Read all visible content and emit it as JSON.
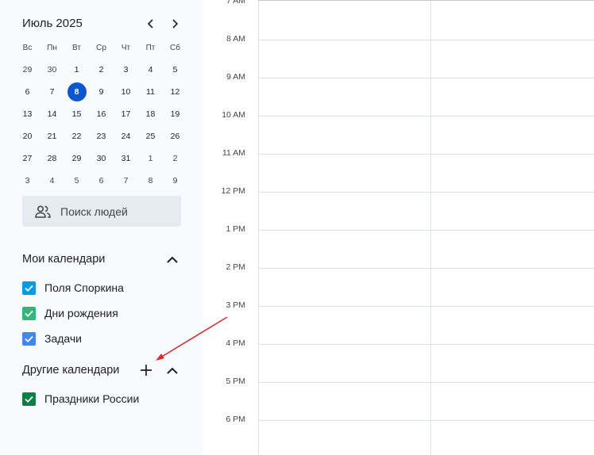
{
  "mini_calendar": {
    "month_title": "Июль 2025",
    "prev_icon": "chevron-left-icon",
    "next_icon": "chevron-right-icon",
    "weekdays": [
      "Вс",
      "Пн",
      "Вт",
      "Ср",
      "Чт",
      "Пт",
      "Сб"
    ],
    "weeks": [
      [
        "29",
        "30",
        "1",
        "2",
        "3",
        "4",
        "5"
      ],
      [
        "6",
        "7",
        "8",
        "9",
        "10",
        "11",
        "12"
      ],
      [
        "13",
        "14",
        "15",
        "16",
        "17",
        "18",
        "19"
      ],
      [
        "20",
        "21",
        "22",
        "23",
        "24",
        "25",
        "26"
      ],
      [
        "27",
        "28",
        "29",
        "30",
        "31",
        "1",
        "2"
      ],
      [
        "3",
        "4",
        "5",
        "6",
        "7",
        "8",
        "9"
      ]
    ],
    "today": "8",
    "today_color": "#0b57d0"
  },
  "people_search": {
    "label": "Поиск людей",
    "icon": "people-icon"
  },
  "my_calendars": {
    "title": "Мои календари",
    "items": [
      {
        "label": "Поля Споркина",
        "color": "#039be5",
        "checked": true
      },
      {
        "label": "Дни рождения",
        "color": "#33b679",
        "checked": true
      },
      {
        "label": "Задачи",
        "color": "#4285f4",
        "checked": true
      }
    ]
  },
  "other_calendars": {
    "title": "Другие календари",
    "add_icon": "plus-icon",
    "items": [
      {
        "label": "Праздники России",
        "color": "#0b8043",
        "checked": true
      }
    ]
  },
  "time_grid": {
    "hours": [
      "7 AM",
      "8 AM",
      "9 AM",
      "10 AM",
      "11 AM",
      "12 PM",
      "1 PM",
      "2 PM",
      "3 PM",
      "4 PM",
      "5 PM",
      "6 PM"
    ],
    "annotation_color": "#d32f2f"
  }
}
